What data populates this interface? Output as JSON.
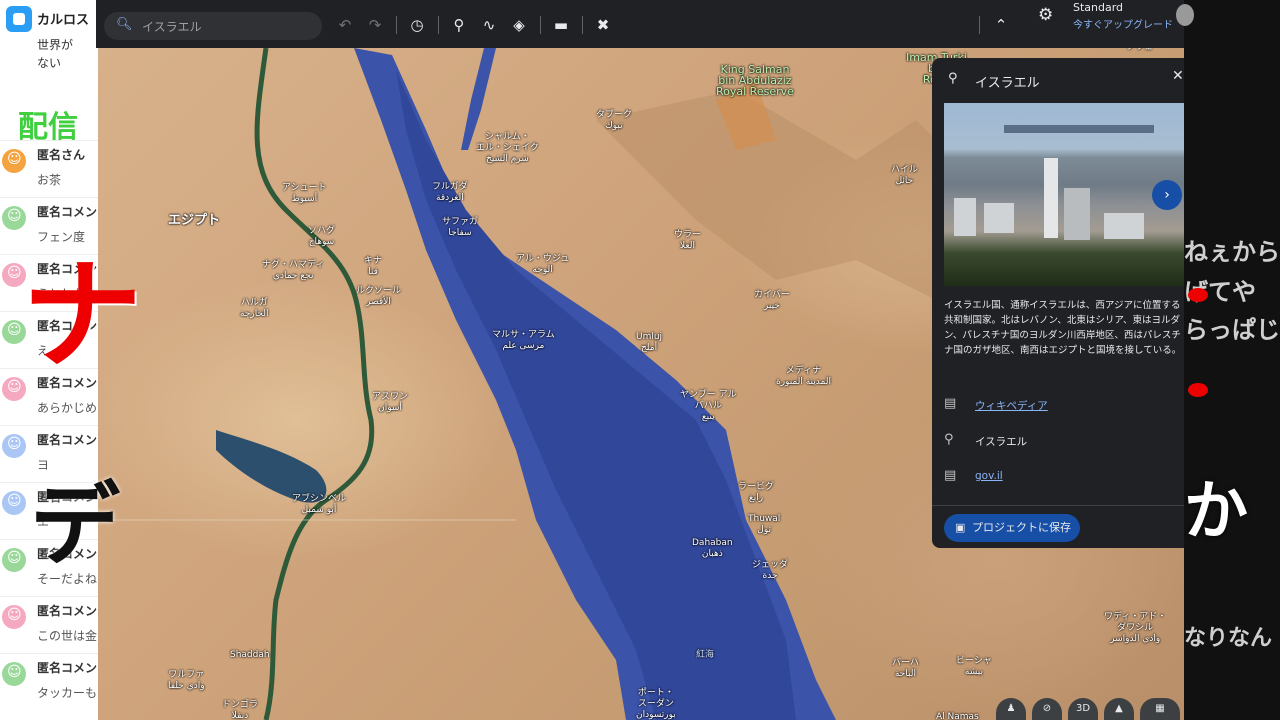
{
  "chat": {
    "channel_name": "カルロス",
    "top_lines": [
      "世界が",
      "ない"
    ],
    "overlay_text_1": "配信",
    "comments": [
      {
        "name": "匿名さん",
        "text": "お茶",
        "avatar_color": "#f4a340"
      },
      {
        "name": "匿名コメン",
        "text": "フェン度",
        "avatar_color": "#9ad89a"
      },
      {
        "name": "匿名コメン",
        "text": "うとした",
        "avatar_color": "#f5a9c0"
      },
      {
        "name": "匿名コメン",
        "text": "え、問",
        "avatar_color": "#9ad89a"
      },
      {
        "name": "匿名コメン",
        "text": "あらかじめ",
        "avatar_color": "#f5a9c0"
      },
      {
        "name": "匿名コメン",
        "text": "ヨ",
        "avatar_color": "#a9c6f5"
      },
      {
        "name": "匿名コメン",
        "text": "エ",
        "avatar_color": "#a9c6f5"
      },
      {
        "name": "匿名コメン",
        "text": "そーだよね",
        "avatar_color": "#9ad89a"
      },
      {
        "name": "匿名コメン",
        "text": "この世は金",
        "avatar_color": "#f5a9c0"
      },
      {
        "name": "匿名コメン",
        "text": "タッカーも",
        "avatar_color": "#9ad89a"
      }
    ],
    "overlay_big_1": "ナ",
    "overlay_big_2": "デ"
  },
  "toolbar": {
    "search_placeholder": "イスラエル",
    "search_icon": "search-icon",
    "undo_icon": "undo-icon",
    "redo_icon": "redo-icon",
    "history_icon": "history-icon",
    "placemark_icon": "placemark-icon",
    "path_icon": "path-icon",
    "layers_icon": "layers-icon",
    "measure_icon": "ruler-icon",
    "satellite_icon": "satellite-icon",
    "collapse_icon": "chevron-up-icon"
  },
  "account": {
    "plan": "Standard",
    "upgrade": "今すぐアップグレード",
    "settings_icon": "gear-icon"
  },
  "map": {
    "labels": [
      {
        "text": "エジプト",
        "kind": "big"
      },
      {
        "text": "King Salman\nbin Abdulaziz\nRoyal Reserve",
        "kind": "green"
      },
      {
        "text": "Imam Turki\nbin\nRoya",
        "kind": "green"
      },
      {
        "text": "クウェ",
        "kind": "normal"
      },
      {
        "text": "タブーク\nتبوك",
        "kind": "normal"
      },
      {
        "text": "シャルム・\nエル・シェイク\nشرم الشيخ",
        "kind": "normal"
      },
      {
        "text": "フルガダ\nالغردقة",
        "kind": "normal"
      },
      {
        "text": "アシュート\nأسيوط",
        "kind": "normal"
      },
      {
        "text": "サファガ\nسفاجا",
        "kind": "normal"
      },
      {
        "text": "ハイル\nحائل",
        "kind": "normal"
      },
      {
        "text": "ソハグ\nسوهاج",
        "kind": "normal"
      },
      {
        "text": "ナグ・ハマディ\nنجع حمادي",
        "kind": "normal"
      },
      {
        "text": "キナ\nقنا",
        "kind": "normal"
      },
      {
        "text": "ウラー\nالعلا",
        "kind": "normal"
      },
      {
        "text": "アル・ウジュ\nالوجه",
        "kind": "normal"
      },
      {
        "text": "ルクソール\nالأقصر",
        "kind": "normal"
      },
      {
        "text": "ハルガ\nالخارجة",
        "kind": "normal"
      },
      {
        "text": "カイバー\nخيبر",
        "kind": "normal"
      },
      {
        "text": "マルサ・アラム\nمرسى علم",
        "kind": "normal"
      },
      {
        "text": "Umluj\nأملج",
        "kind": "normal"
      },
      {
        "text": "メディナ\nالمدينة المنورة",
        "kind": "normal"
      },
      {
        "text": "アスワン\nأسوان",
        "kind": "normal"
      },
      {
        "text": "ヤンブー アル\nバハル\nينبع",
        "kind": "normal"
      },
      {
        "text": "アブシンベル\nأبو سمبل",
        "kind": "normal"
      },
      {
        "text": "ラービグ\nرابغ",
        "kind": "normal"
      },
      {
        "text": "Thuwal\nثول",
        "kind": "normal"
      },
      {
        "text": "Dahaban\nذهبان",
        "kind": "normal"
      },
      {
        "text": "ジェッダ\nجدة",
        "kind": "normal"
      },
      {
        "text": "ワディ・アド・\nダワシル\nوادي الدواسر",
        "kind": "normal"
      },
      {
        "text": "Shaddah",
        "kind": "normal"
      },
      {
        "text": "紅海",
        "kind": "sea"
      },
      {
        "text": "バーハ\nالباحة",
        "kind": "normal"
      },
      {
        "text": "ビーシャ\nبيشة",
        "kind": "normal"
      },
      {
        "text": "ワルファ\nوادي حلفا",
        "kind": "normal"
      },
      {
        "text": "ドンゴラ\nدنقلا",
        "kind": "normal"
      },
      {
        "text": "ポート・\nスーダン\nبورتسودان",
        "kind": "normal"
      },
      {
        "text": "Al Namas",
        "kind": "normal"
      }
    ],
    "bottom_controls": [
      "pegman-icon",
      "compass-off-icon",
      "3D",
      "compass-icon",
      "grid-icon"
    ]
  },
  "panel": {
    "title": "イスラエル",
    "close_icon": "close-icon",
    "description": "イスラエル国、通称イスラエルは、西アジアに位置する共和制国家。北はレバノン、北東はシリア、東はヨルダン、パレスチナ国のヨルダン川西岸地区、西はパレスチナ国のガザ地区、南西はエジプトと国境を接している。",
    "rows": [
      {
        "icon": "wiki-icon",
        "text": "ウィキペディア",
        "link": true
      },
      {
        "icon": "place-icon",
        "text": "イスラエル",
        "link": false
      },
      {
        "icon": "web-icon",
        "text": "gov.il",
        "link": true
      }
    ],
    "save_label": "プロジェクトに保存"
  },
  "right_strip": {
    "lines": [
      "ねぇから",
      "げてや",
      "らっぱじ"
    ],
    "big_char": "か",
    "bottom_line": "なりなん"
  }
}
